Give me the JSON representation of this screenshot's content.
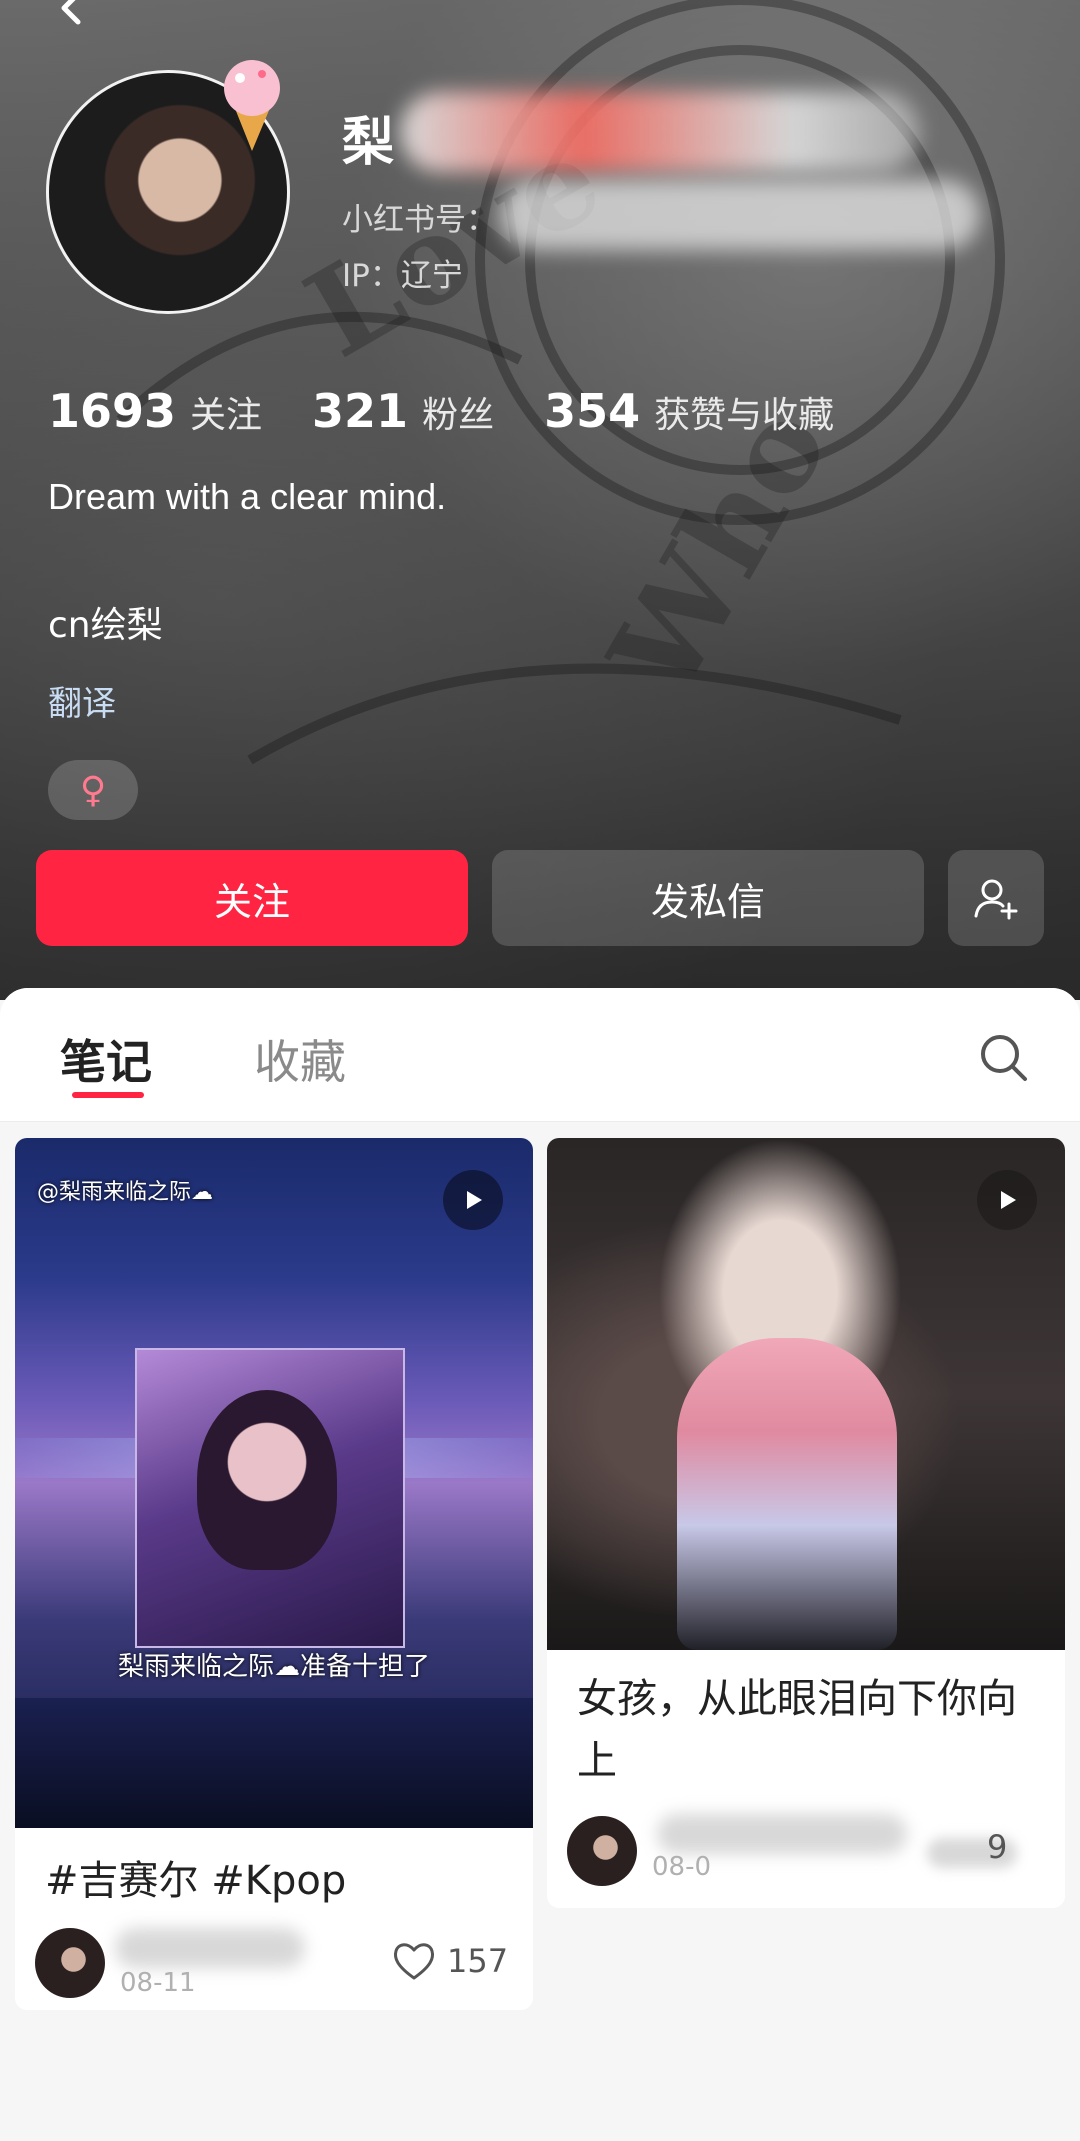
{
  "profile": {
    "name_visible": "梨",
    "redbook_id_label": "小红书号：",
    "ip_label": "IP：辽宁",
    "stats": [
      {
        "value": "1693",
        "label": "关注"
      },
      {
        "value": "321",
        "label": "粉丝"
      },
      {
        "value": "354",
        "label": "获赞与收藏"
      }
    ],
    "bio": "Dream with a clear mind.",
    "bio2": "cn绘梨",
    "translate": "翻译",
    "gender_symbol": "♀"
  },
  "actions": {
    "follow": "关注",
    "message": "发私信"
  },
  "tabs": {
    "notes": "笔记",
    "collections": "收藏"
  },
  "notes": [
    {
      "cover_tag": "@梨雨来临之际☁",
      "cover_caption": "梨雨来临之际☁准备十担了",
      "title": "#吉赛尔 #Kpop",
      "date": "08-11",
      "likes": "157"
    },
    {
      "title": "女孩，从此眼泪向下你向上",
      "date": "08-0",
      "likes": "9"
    }
  ],
  "colors": {
    "accent": "#ff2442",
    "translate_link": "#c8dcf4"
  }
}
